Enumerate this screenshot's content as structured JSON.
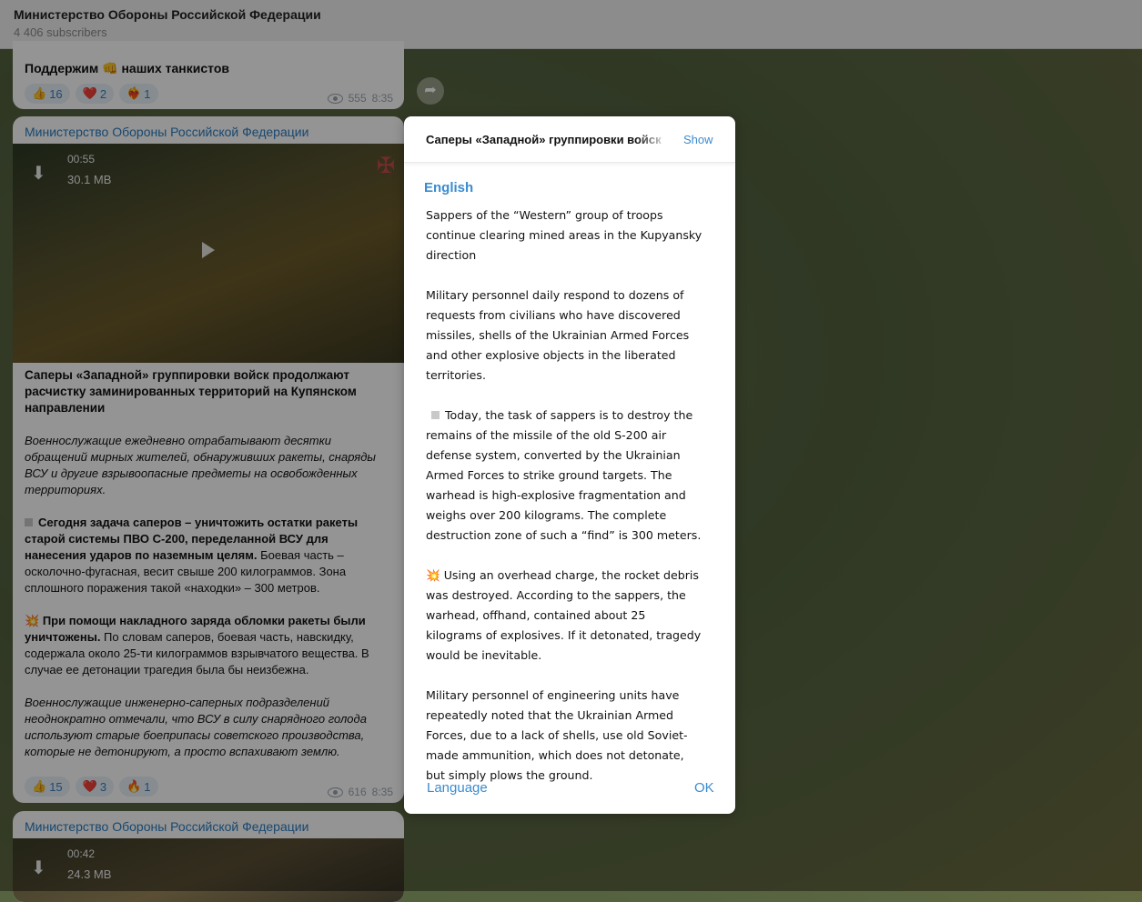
{
  "header": {
    "title": "Министерство Обороны Российской Федерации",
    "subtitle": "4 406 subscribers"
  },
  "prev_post": {
    "text": "Поддержим 👊 наших танкистов",
    "reactions": [
      {
        "icon": "👍",
        "count": "16"
      },
      {
        "icon": "❤️",
        "count": "2"
      },
      {
        "icon": "❤️‍🔥",
        "count": "1"
      }
    ],
    "views": "555",
    "time": "8:35"
  },
  "post": {
    "sender": "Министерство Обороны Российской Федерации",
    "video_duration": "00:55",
    "video_size": "30.1 MB",
    "headline": "Саперы «Западной» группировки войск продолжают расчистку заминированных территорий на Купянском направлении",
    "p1": "Военнослужащие ежедневно отрабатывают десятки обращений мирных жителей, обнаруживших ракеты, снаряды ВСУ и другие взрывоопасные предметы на освобожденных территориях.",
    "p2_bold": "Сегодня задача саперов – уничтожить остатки ракеты старой системы ПВО С-200, переделанной ВСУ для нанесения ударов по наземным целям.",
    "p2_rest": " Боевая часть – осколочно-фугасная, весит свыше 200 килограммов. Зона сплошного поражения такой «находки» – 300 метров.",
    "p3_emoji": "💥",
    "p3_bold": "При помощи накладного заряда обломки ракеты были уничтожены.",
    "p3_rest": " По словам саперов, боевая часть, навскидку, содержала около 25-ти килограммов взрывчатого вещества. В случае ее детонации трагедия была бы неизбежна.",
    "p4": "Военнослужащие инженерно-саперных подразделений неоднократно отмечали, что ВСУ в силу снарядного голода используют старые боеприпасы советского производства, которые не детонируют, а просто вспахивают землю.",
    "reactions": [
      {
        "icon": "👍",
        "count": "15"
      },
      {
        "icon": "❤️",
        "count": "3"
      },
      {
        "icon": "🔥",
        "count": "1"
      }
    ],
    "views": "616",
    "time": "8:35"
  },
  "next_post": {
    "sender": "Министерство Обороны Российской Федерации",
    "video_duration": "00:42",
    "video_size": "24.3 MB"
  },
  "dialog": {
    "original_preview": "Саперы «Западной» группировки войск продолжают",
    "show_label": "Show",
    "language_header": "English",
    "t1": "Sappers of the “Western” group of troops continue clearing mined areas in the Kupyansky direction",
    "t2": "Military personnel daily respond to dozens of requests from civilians who have discovered missiles, shells of the Ukrainian Armed Forces and other explosive objects in the liberated territories.",
    "t3": "Today, the task of sappers is to destroy the remains of the missile of the old S-200 air defense system, converted by the Ukrainian Armed Forces to strike ground targets. The warhead is high-explosive fragmentation and weighs over 200 kilograms. The complete destruction zone of such a “find” is 300 meters.",
    "t4_emoji": "💥",
    "t4": " Using an overhead charge, the rocket debris was destroyed. According to the sappers, the warhead, offhand, contained about 25 kilograms of explosives. If it detonated, tragedy would be inevitable.",
    "t5": "Military personnel of engineering units have repeatedly noted that the Ukrainian Armed Forces, due to a lack of shells, use old Soviet-made ammunition, which does not detonate, but simply plows the ground.",
    "language_button": "Language",
    "ok_button": "OK"
  }
}
